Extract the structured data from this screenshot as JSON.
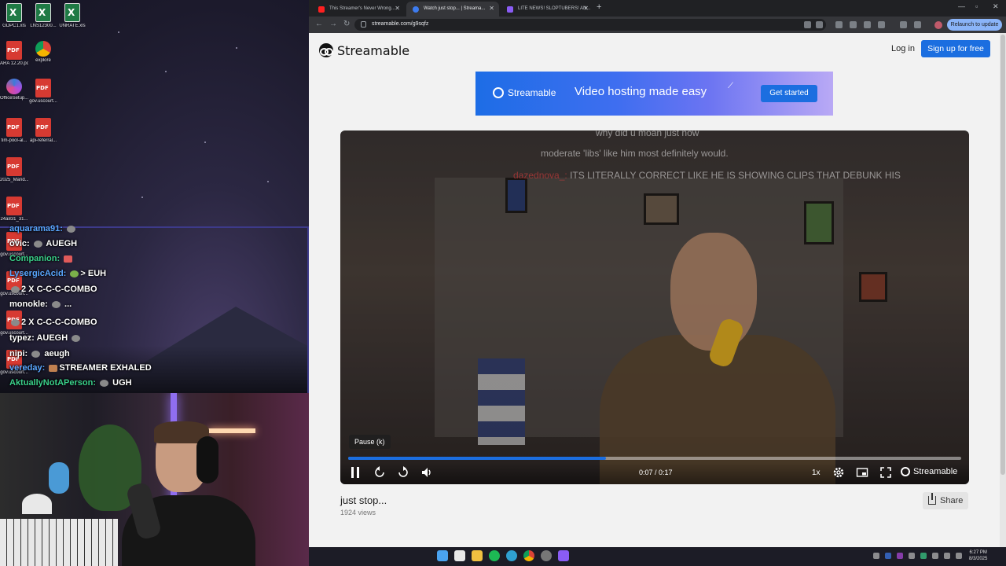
{
  "desktop": {
    "icons": [
      {
        "label": "GDPC1.xls",
        "type": "xls"
      },
      {
        "label": "LNS12300...",
        "type": "xls"
      },
      {
        "label": "UNRATE.xls",
        "type": "xls"
      },
      {
        "label": "ARA 12.20.pdf",
        "type": "pdf"
      },
      {
        "label": "explore",
        "type": "chrome"
      },
      {
        "label": "OfficeSetup...",
        "type": "office"
      },
      {
        "label": "gov.uscourt...",
        "type": "pdf"
      },
      {
        "label": "tim-pool-al...",
        "type": "pdf"
      },
      {
        "label": "api-referral...",
        "type": "pdf"
      },
      {
        "label": "2025_Mand...",
        "type": "pdf"
      },
      {
        "label": "24a831_31...",
        "type": "pdf"
      },
      {
        "label": "gov.uscourt...",
        "type": "pdf"
      },
      {
        "label": "gov.uscourt...",
        "type": "pdf"
      },
      {
        "label": "gov.uscourt...",
        "type": "pdf"
      },
      {
        "label": "gov.uscourt...",
        "type": "pdf"
      }
    ]
  },
  "chat": {
    "lines": [
      {
        "user": "aquarama91:",
        "text": ""
      },
      {
        "user": "ovic:",
        "text": "AUEGH"
      },
      {
        "user": "Companion:",
        "text": ""
      },
      {
        "user": "LysergicAcid:",
        "text": "> EUH"
      },
      {
        "user": "",
        "text": "2 X  C-C-C-COMBO"
      },
      {
        "user": "monokle:",
        "text": "..."
      },
      {
        "user": "",
        "text": "2 X  C-C-C-COMBO"
      },
      {
        "user": "typez:",
        "text": "AUEGH"
      },
      {
        "user": "nipi:",
        "text": "aeugh"
      },
      {
        "user": "vereday:",
        "text": "STREAMER EXHALED"
      },
      {
        "user": "AktuallyNotAPerson:",
        "text": "UGH"
      }
    ]
  },
  "browser": {
    "tabs": [
      {
        "title": "This Streamer's Never Wrong...",
        "active": false,
        "fav_color": "#ff2020"
      },
      {
        "title": "Watch just stop... | Streama...",
        "active": true,
        "fav_color": "#3d7cf0"
      },
      {
        "title": "LITE NEWS! SLOPTUBERS! AN...",
        "active": false,
        "fav_color": "#8a5cf5"
      }
    ],
    "url": "streamable.com/g9sqfz",
    "relaunch": "Relaunch to update"
  },
  "site": {
    "brand": "Streamable",
    "login": "Log in",
    "signup": "Sign up for free",
    "banner": {
      "brand": "Streamable",
      "tagline": "Video hosting made easy",
      "cta": "Get started"
    },
    "video": {
      "tooltip": "Pause (k)",
      "time": "0:07 / 0:17",
      "speed": "1x",
      "progress_fraction": 0.42,
      "brand": "Streamable",
      "overlay_chat": [
        {
          "user": "",
          "text": "why did u moan just now"
        },
        {
          "user": "",
          "text": "moderate 'libs' like him most definitely would."
        },
        {
          "user": "dazednova_:",
          "text": "ITS LITERALLY CORRECT LIKE HE IS SHOWING CLIPS THAT DEBUNK HIS"
        }
      ]
    },
    "title": "just stop...",
    "views": "1924 views",
    "share": "Share"
  },
  "taskbar": {
    "time": "6:27 PM",
    "date": "8/3/2025"
  }
}
